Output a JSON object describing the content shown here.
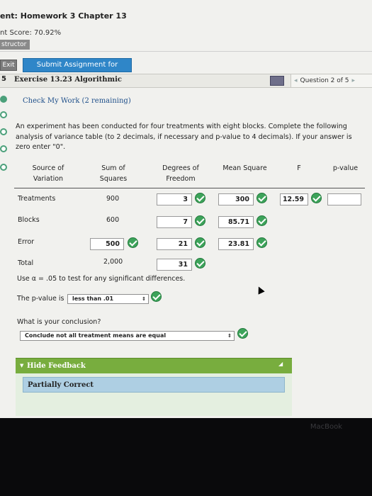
{
  "header": {
    "title": "ent: Homework 3 Chapter 13",
    "score": "nt Score: 70.92%",
    "instructor_tab": "structor"
  },
  "toolbar": {
    "exit_label": "Exit",
    "submit_label": "Submit Assignment for Grading"
  },
  "exercise": {
    "number": "5",
    "title": "Exercise 13.23 Algorithmic",
    "question_nav": "Question 2 of 5"
  },
  "check_work": "Check My Work (2 remaining)",
  "problem_text": "An experiment has been conducted for four treatments with eight blocks. Complete the following analysis of variance table (to 2 decimals, if necessary and p-value to 4 decimals). If your answer is zero enter \"0\".",
  "table": {
    "headers": {
      "source_line1": "Source of",
      "source_line2": "Variation",
      "ss_line1": "Sum of",
      "ss_line2": "Squares",
      "df_line1": "Degrees of",
      "df_line2": "Freedom",
      "ms": "Mean Square",
      "f": "F",
      "p": "p-value"
    },
    "rows": [
      {
        "source": "Treatments",
        "ss": "900",
        "df": "3",
        "ms": "300",
        "f": "12.59",
        "p": ""
      },
      {
        "source": "Blocks",
        "ss": "600",
        "df": "7",
        "ms": "85.71"
      },
      {
        "source": "Error",
        "ss": "500",
        "df": "21",
        "ms": "23.81"
      },
      {
        "source": "Total",
        "ss": "2,000",
        "df": "31"
      }
    ]
  },
  "alpha_text": "Use α = .05 to test for any significant differences.",
  "pvalue_question": "The p-value is",
  "pvalue_selected": "less than .01",
  "conclusion_question": "What is your conclusion?",
  "conclusion_selected": "Conclude not all treatment means are equal",
  "feedback": {
    "toggle_label": "Hide Feedback",
    "status": "Partially Correct"
  },
  "device_label": "MacBook",
  "colors": {
    "submit_button": "#2f86c8",
    "correct_check": "#3da35a",
    "feedback_bar": "#78ad3e",
    "feedback_panel": "#aecfe3"
  }
}
